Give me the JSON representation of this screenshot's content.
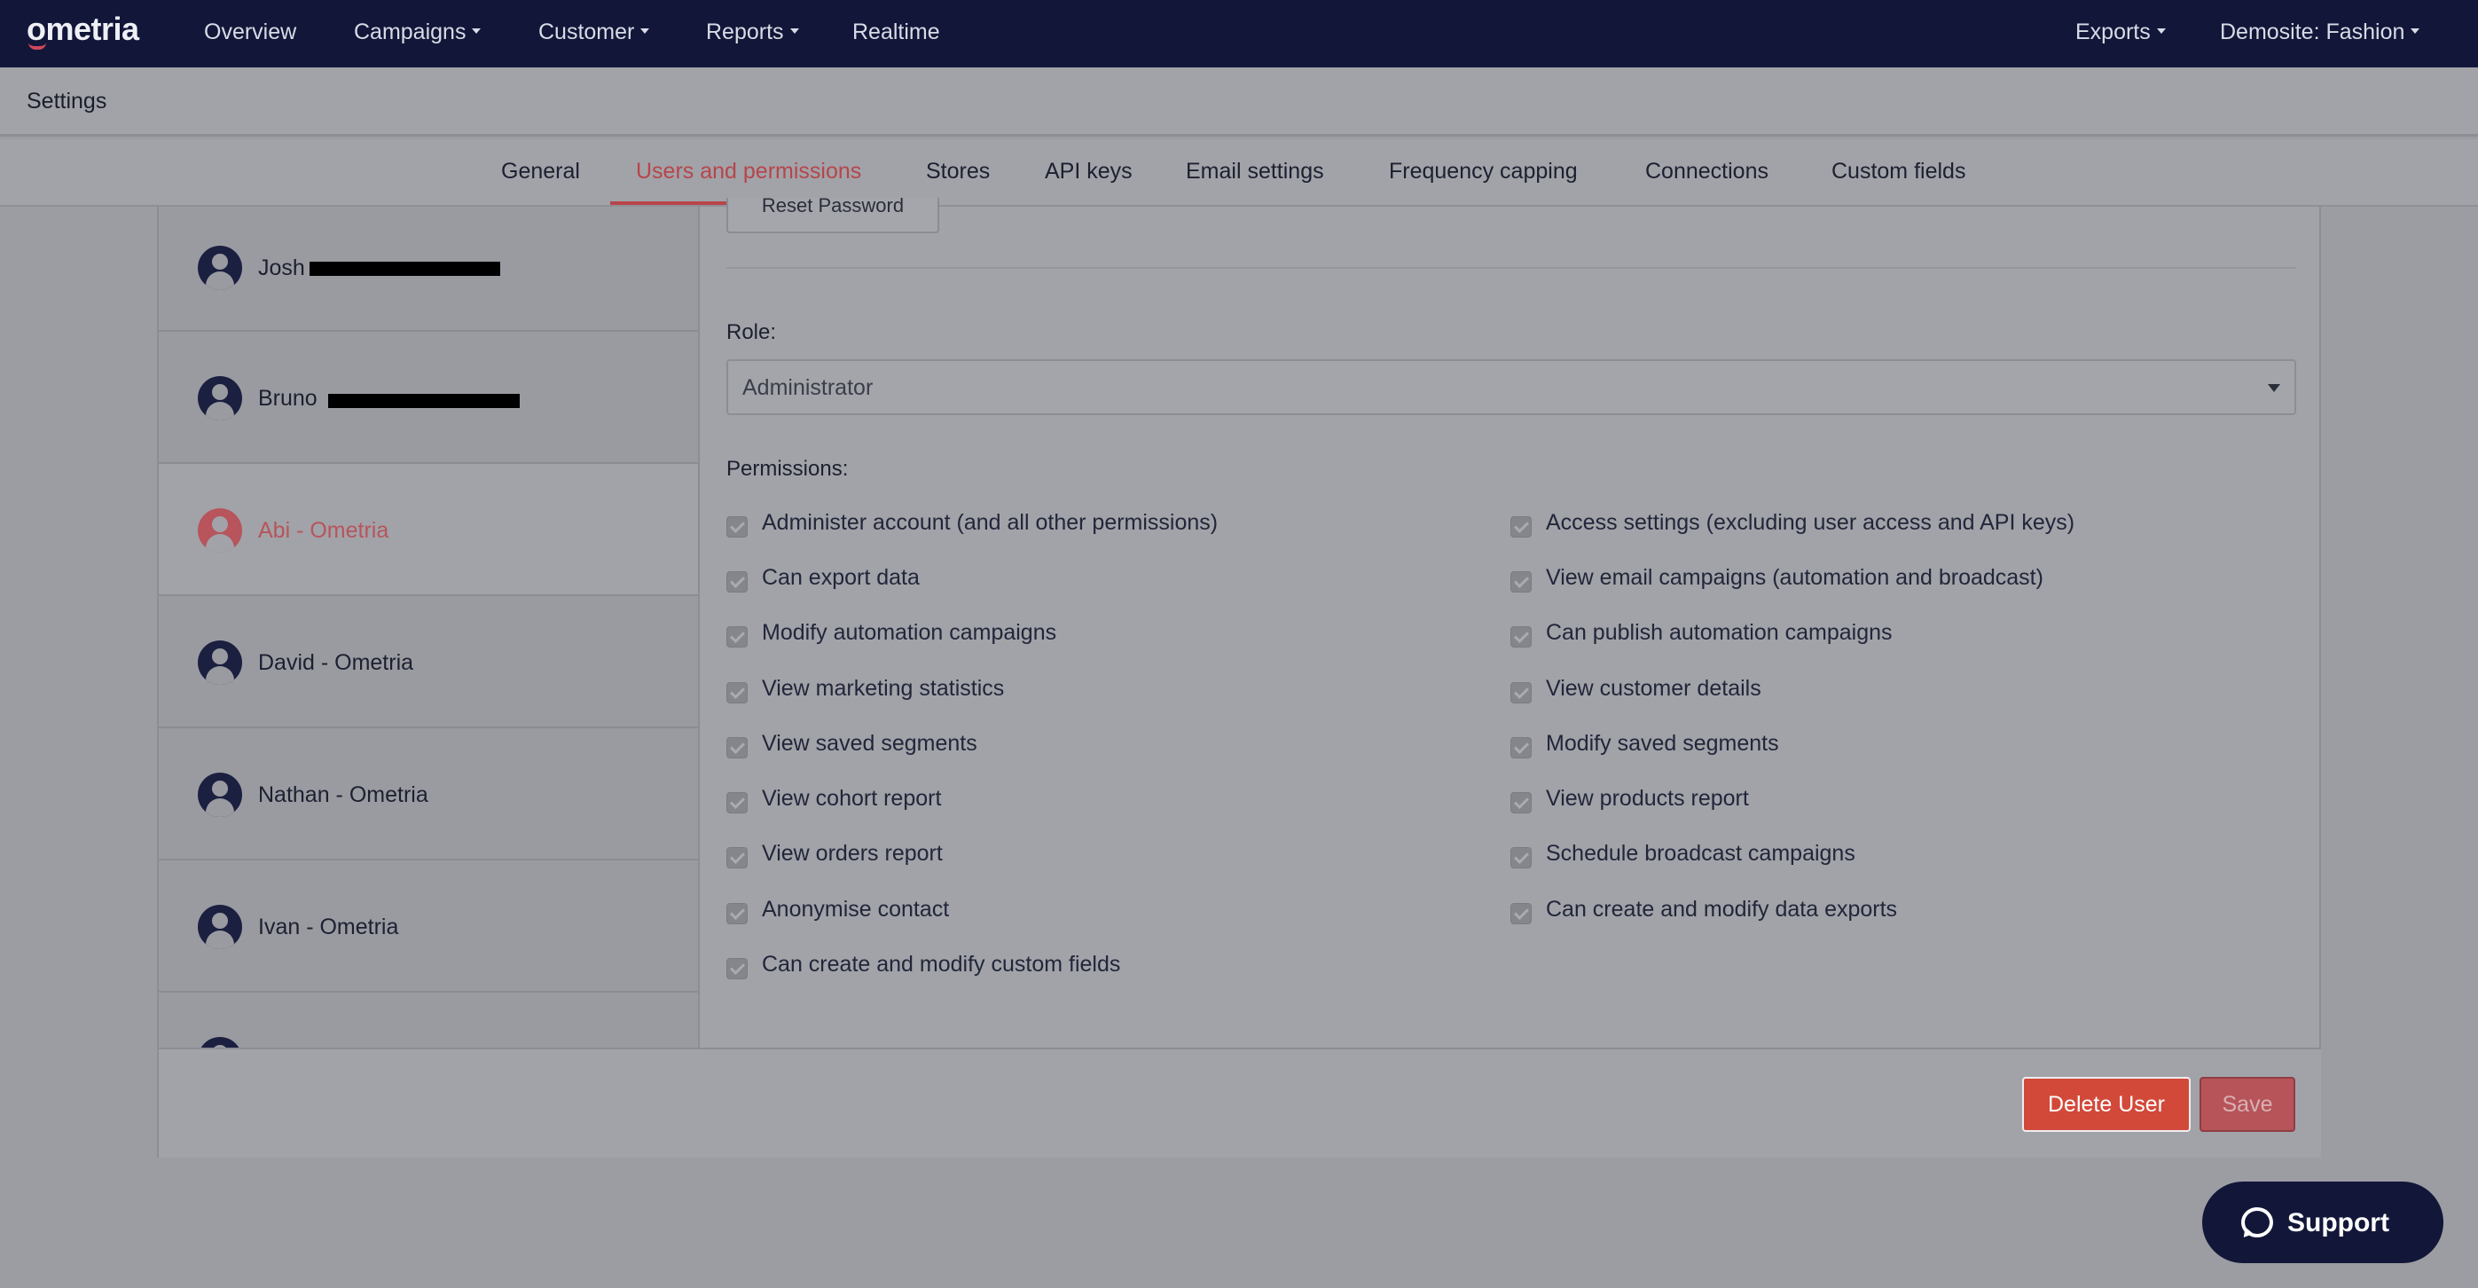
{
  "topnav": {
    "logo": "ometria",
    "items": [
      {
        "label": "Overview",
        "dropdown": false
      },
      {
        "label": "Campaigns",
        "dropdown": true
      },
      {
        "label": "Customer",
        "dropdown": true
      },
      {
        "label": "Reports",
        "dropdown": true
      },
      {
        "label": "Realtime",
        "dropdown": false
      }
    ],
    "right_items": [
      {
        "label": "Exports",
        "dropdown": true
      },
      {
        "label": "Demosite: Fashion",
        "dropdown": true
      }
    ]
  },
  "settings_title": "Settings",
  "tabs": [
    {
      "label": "General",
      "active": false
    },
    {
      "label": "Users and permissions",
      "active": true
    },
    {
      "label": "Stores",
      "active": false
    },
    {
      "label": "API keys",
      "active": false
    },
    {
      "label": "Email settings",
      "active": false
    },
    {
      "label": "Frequency capping",
      "active": false
    },
    {
      "label": "Connections",
      "active": false
    },
    {
      "label": "Custom fields",
      "active": false
    }
  ],
  "users": [
    {
      "name": "Josh",
      "redacted": true,
      "active": false
    },
    {
      "name": "Bruno",
      "redacted": true,
      "active": false
    },
    {
      "name": "Abi - Ometria",
      "redacted": false,
      "active": true
    },
    {
      "name": "David - Ometria",
      "redacted": false,
      "active": false
    },
    {
      "name": "Nathan - Ometria",
      "redacted": false,
      "active": false
    },
    {
      "name": "Ivan - Ometria",
      "redacted": false,
      "active": false
    }
  ],
  "detail": {
    "reset_password_label": "Reset Password",
    "role_label": "Role:",
    "role_value": "Administrator",
    "permissions_label": "Permissions:",
    "permissions_left": [
      "Administer account (and all other permissions)",
      "Can export data",
      "Modify automation campaigns",
      "View marketing statistics",
      "View saved segments",
      "View cohort report",
      "View orders report",
      "Anonymise contact",
      "Can create and modify custom fields"
    ],
    "permissions_right": [
      "Access settings (excluding user access and API keys)",
      "View email campaigns (automation and broadcast)",
      "Can publish automation campaigns",
      "View customer details",
      "Modify saved segments",
      "View products report",
      "Schedule broadcast campaigns",
      "Can create and modify data exports"
    ]
  },
  "footer": {
    "delete_label": "Delete User",
    "save_label": "Save"
  },
  "support_label": "Support",
  "colors": {
    "nav_bg": "#121739",
    "accent": "#b7454a",
    "delete_button": "#d2493a"
  }
}
